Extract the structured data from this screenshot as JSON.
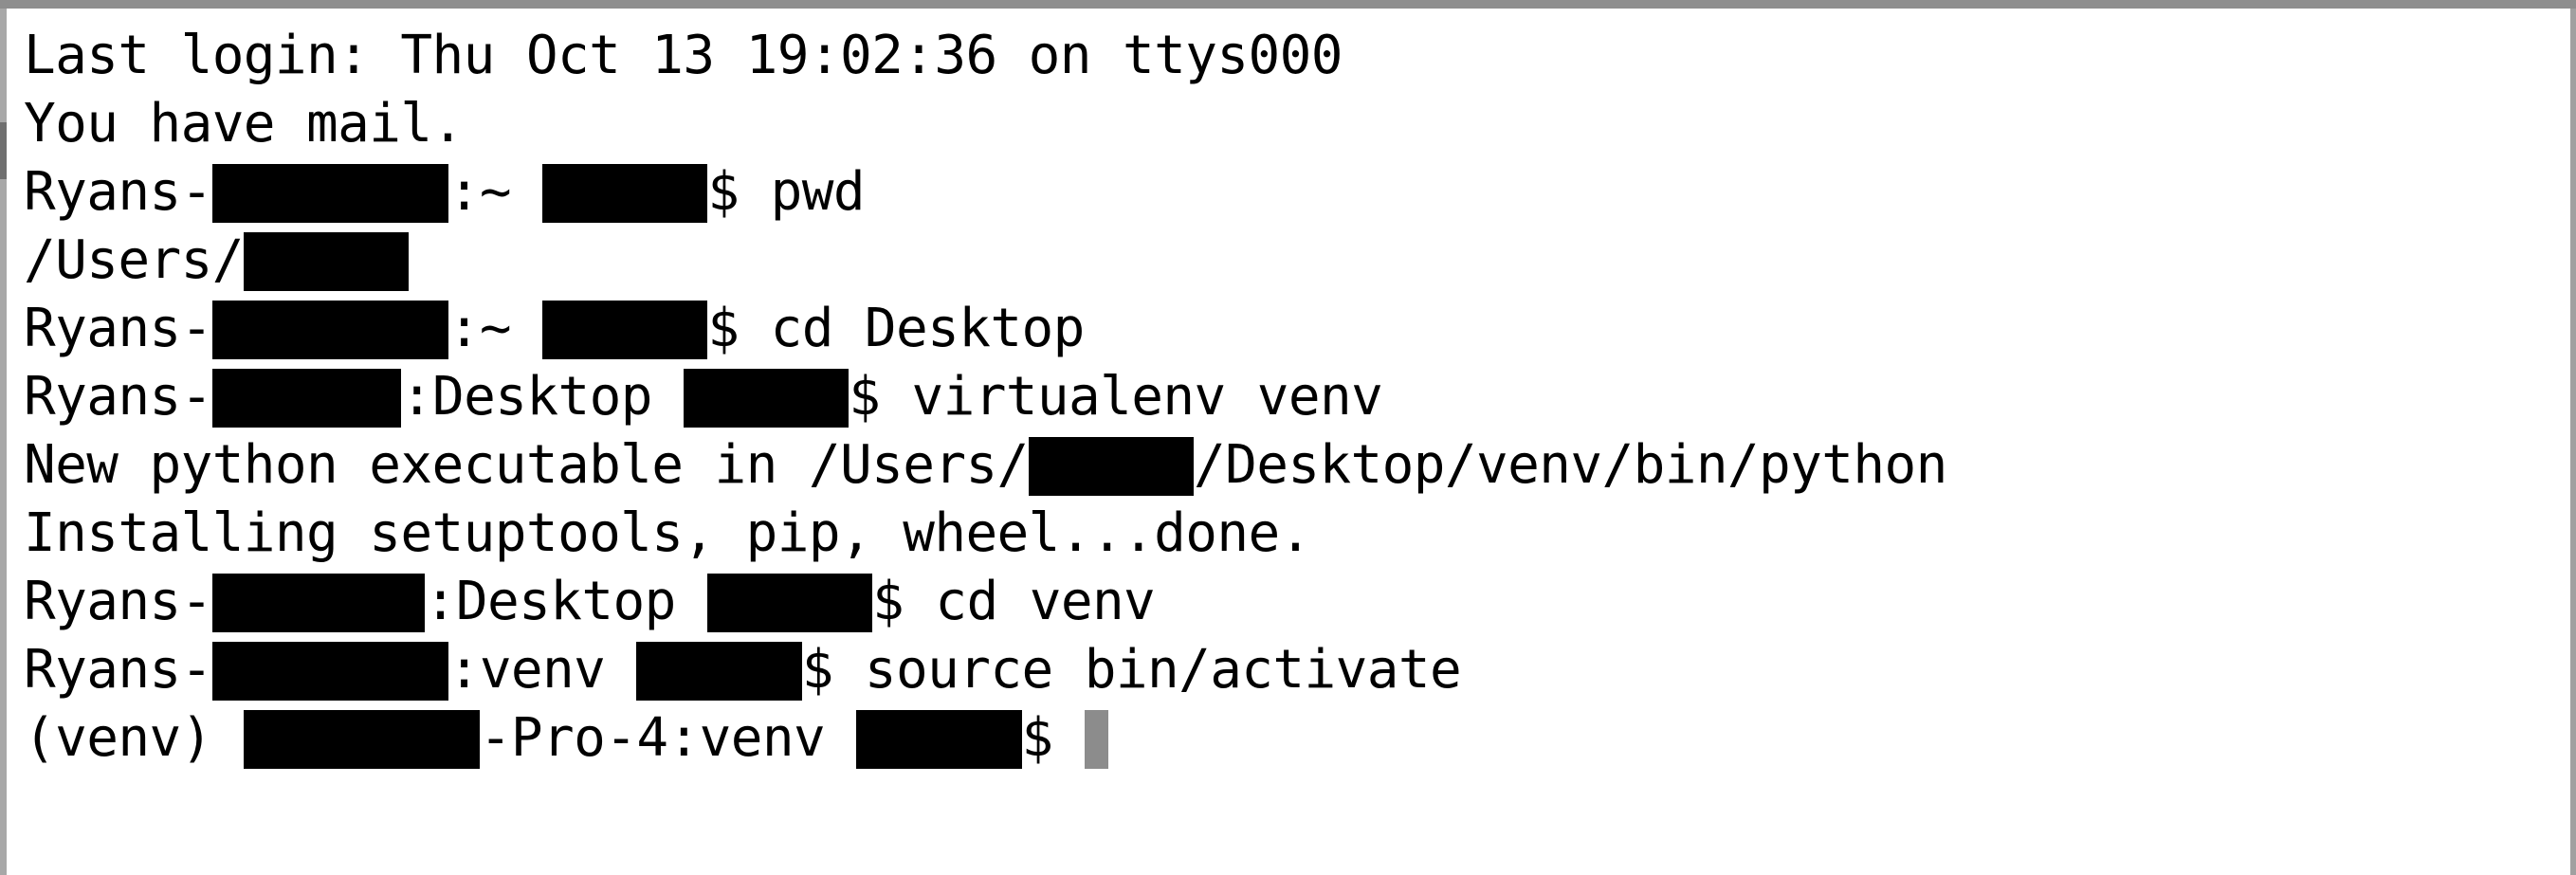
{
  "window": {
    "title": "Terminal",
    "chrome_color": "#8e8e8e",
    "background_color": "#ffffff",
    "text_color": "#000000",
    "cursor_color": "#8c8c8c",
    "redaction_color": "#000000"
  },
  "terminal": {
    "lines": [
      {
        "id": "line-1",
        "kind": "output",
        "segments": [
          {
            "type": "text",
            "value": "Last login: Thu Oct 13 19:02:36 on ttys000"
          }
        ]
      },
      {
        "id": "line-2",
        "kind": "output",
        "segments": [
          {
            "type": "text",
            "value": "You have mail."
          }
        ]
      },
      {
        "id": "line-3",
        "kind": "prompt",
        "segments": [
          {
            "type": "text",
            "value": "Ryans-"
          },
          {
            "type": "redaction",
            "chars": 10
          },
          {
            "type": "text",
            "value": ":~ "
          },
          {
            "type": "redaction",
            "chars": 7
          },
          {
            "type": "text",
            "value": "$ pwd"
          }
        ]
      },
      {
        "id": "line-4",
        "kind": "output",
        "segments": [
          {
            "type": "text",
            "value": "/Users/"
          },
          {
            "type": "redaction",
            "chars": 7
          }
        ]
      },
      {
        "id": "line-5",
        "kind": "prompt",
        "segments": [
          {
            "type": "text",
            "value": "Ryans-"
          },
          {
            "type": "redaction",
            "chars": 10
          },
          {
            "type": "text",
            "value": ":~ "
          },
          {
            "type": "redaction",
            "chars": 7
          },
          {
            "type": "text",
            "value": "$ cd Desktop"
          }
        ]
      },
      {
        "id": "line-6",
        "kind": "prompt",
        "segments": [
          {
            "type": "text",
            "value": "Ryans-"
          },
          {
            "type": "redaction",
            "chars": 8
          },
          {
            "type": "text",
            "value": ":Desktop "
          },
          {
            "type": "redaction",
            "chars": 7
          },
          {
            "type": "text",
            "value": "$ virtualenv venv"
          }
        ]
      },
      {
        "id": "line-7",
        "kind": "output",
        "segments": [
          {
            "type": "text",
            "value": "New python executable in /Users/"
          },
          {
            "type": "redaction",
            "chars": 7
          },
          {
            "type": "text",
            "value": "/Desktop/venv/bin/python"
          }
        ]
      },
      {
        "id": "line-8",
        "kind": "output",
        "segments": [
          {
            "type": "text",
            "value": "Installing setuptools, pip, wheel...done."
          }
        ]
      },
      {
        "id": "line-9",
        "kind": "prompt",
        "segments": [
          {
            "type": "text",
            "value": "Ryans-"
          },
          {
            "type": "redaction",
            "chars": 9
          },
          {
            "type": "text",
            "value": ":Desktop "
          },
          {
            "type": "redaction",
            "chars": 7
          },
          {
            "type": "text",
            "value": "$ cd venv"
          }
        ]
      },
      {
        "id": "line-10",
        "kind": "prompt",
        "segments": [
          {
            "type": "text",
            "value": "Ryans-"
          },
          {
            "type": "redaction",
            "chars": 10
          },
          {
            "type": "text",
            "value": ":venv "
          },
          {
            "type": "redaction",
            "chars": 7
          },
          {
            "type": "text",
            "value": "$ source bin/activate"
          }
        ]
      },
      {
        "id": "line-11",
        "kind": "prompt-active",
        "segments": [
          {
            "type": "text",
            "value": "(venv) "
          },
          {
            "type": "redaction",
            "chars": 10
          },
          {
            "type": "text",
            "value": "-Pro-4:venv "
          },
          {
            "type": "redaction",
            "chars": 7
          },
          {
            "type": "text",
            "value": "$ "
          },
          {
            "type": "cursor",
            "chars": 1
          }
        ]
      }
    ]
  }
}
